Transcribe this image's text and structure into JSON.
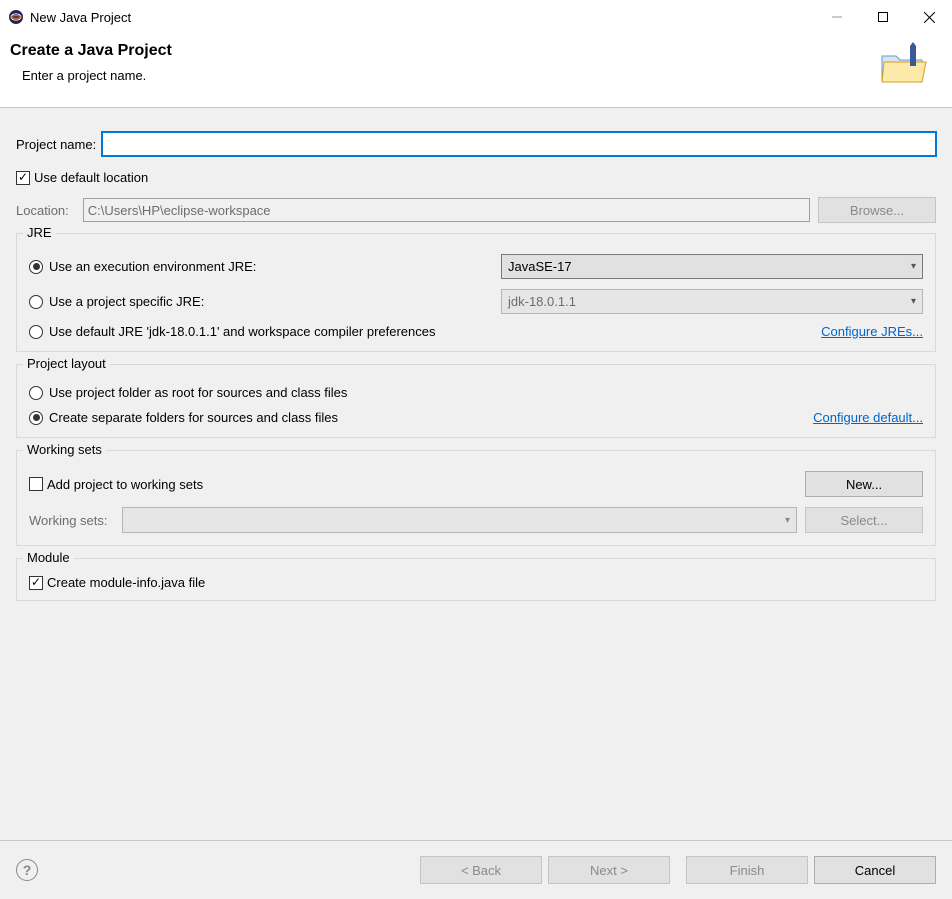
{
  "window": {
    "title": "New Java Project"
  },
  "header": {
    "title": "Create a Java Project",
    "subtitle": "Enter a project name."
  },
  "project_name": {
    "label": "Project name:",
    "value": ""
  },
  "default_location": {
    "label": "Use default location",
    "checked": true
  },
  "location": {
    "label": "Location:",
    "value": "C:\\Users\\HP\\eclipse-workspace",
    "browse_label": "Browse..."
  },
  "jre": {
    "legend": "JRE",
    "option_env": "Use an execution environment JRE:",
    "env_value": "JavaSE-17",
    "option_specific": "Use a project specific JRE:",
    "specific_value": "jdk-18.0.1.1",
    "option_default": "Use default JRE 'jdk-18.0.1.1' and workspace compiler preferences",
    "configure_link": "Configure JREs..."
  },
  "layout": {
    "legend": "Project layout",
    "option_root": "Use project folder as root for sources and class files",
    "option_separate": "Create separate folders for sources and class files",
    "configure_link": "Configure default..."
  },
  "working_sets": {
    "legend": "Working sets",
    "add_label": "Add project to working sets",
    "new_label": "New...",
    "ws_label": "Working sets:",
    "select_label": "Select..."
  },
  "module": {
    "legend": "Module",
    "create_label": "Create module-info.java file",
    "checked": true
  },
  "footer": {
    "back": "< Back",
    "next": "Next >",
    "finish": "Finish",
    "cancel": "Cancel"
  }
}
